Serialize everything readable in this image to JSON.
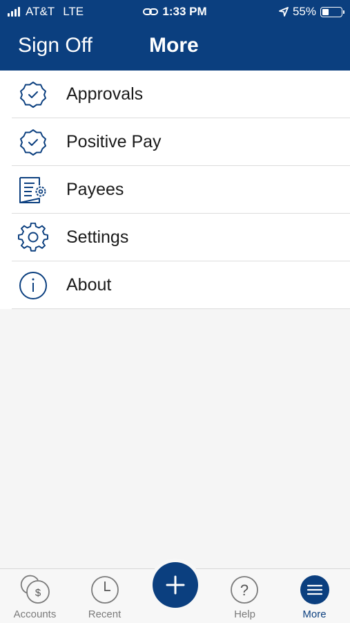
{
  "status_bar": {
    "carrier": "AT&T",
    "network": "LTE",
    "time": "1:33 PM",
    "battery_percent": "55%"
  },
  "navbar": {
    "sign_off_label": "Sign Off",
    "title": "More"
  },
  "menu": {
    "items": [
      {
        "label": "Approvals",
        "icon": "badge-check-icon"
      },
      {
        "label": "Positive Pay",
        "icon": "badge-check-icon"
      },
      {
        "label": "Payees",
        "icon": "document-gear-icon"
      },
      {
        "label": "Settings",
        "icon": "gear-icon"
      },
      {
        "label": "About",
        "icon": "info-icon"
      }
    ]
  },
  "tab_bar": {
    "tabs": [
      {
        "label": "Accounts",
        "icon": "accounts-dollar-icon"
      },
      {
        "label": "Recent",
        "icon": "clock-icon"
      },
      {
        "label": "",
        "icon": "plus-icon"
      },
      {
        "label": "Help",
        "icon": "help-icon"
      },
      {
        "label": "More",
        "icon": "menu-icon",
        "active": true
      }
    ]
  },
  "colors": {
    "brand": "#0b3f7f",
    "background": "#f5f5f5",
    "inactive_tab": "#7a7a7a"
  }
}
